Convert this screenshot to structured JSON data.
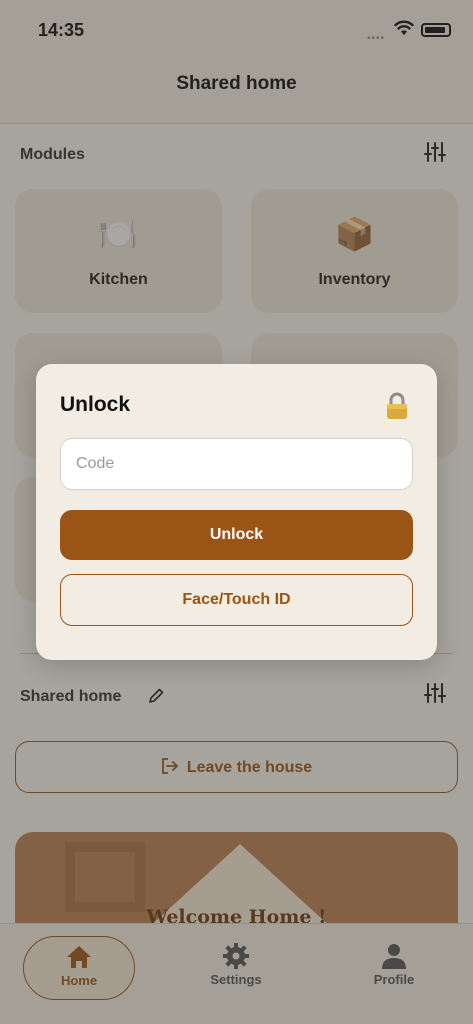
{
  "status_bar": {
    "time": "14:35",
    "signal_dots": "••••"
  },
  "header": {
    "title": "Shared home"
  },
  "modules": {
    "label": "Modules",
    "items": [
      {
        "label": "Kitchen",
        "icon": "plate-cutlery-icon",
        "emoji": "🍽️"
      },
      {
        "label": "Inventory",
        "icon": "package-icon",
        "emoji": "📦"
      },
      {
        "label": "",
        "icon": ""
      },
      {
        "label": "",
        "icon": ""
      },
      {
        "label": "",
        "icon": ""
      }
    ]
  },
  "shared_home": {
    "label": "Shared home",
    "leave_button": "Leave the house"
  },
  "banner": {
    "text": "Welcome Home !"
  },
  "tab_bar": {
    "tabs": [
      {
        "label": "Home",
        "active": true
      },
      {
        "label": "Settings",
        "active": false
      },
      {
        "label": "Profile",
        "active": false
      }
    ]
  },
  "unlock_modal": {
    "title": "Unlock",
    "lock_glyph": "🔒",
    "code_placeholder": "Code",
    "code_value": "",
    "unlock_button": "Unlock",
    "biometric_button": "Face/Touch ID"
  },
  "colors": {
    "accent": "#9a5516",
    "background": "#f4f1ea",
    "modal_background": "#f2ece2",
    "overlay": "rgba(60,58,52,0.42)"
  }
}
